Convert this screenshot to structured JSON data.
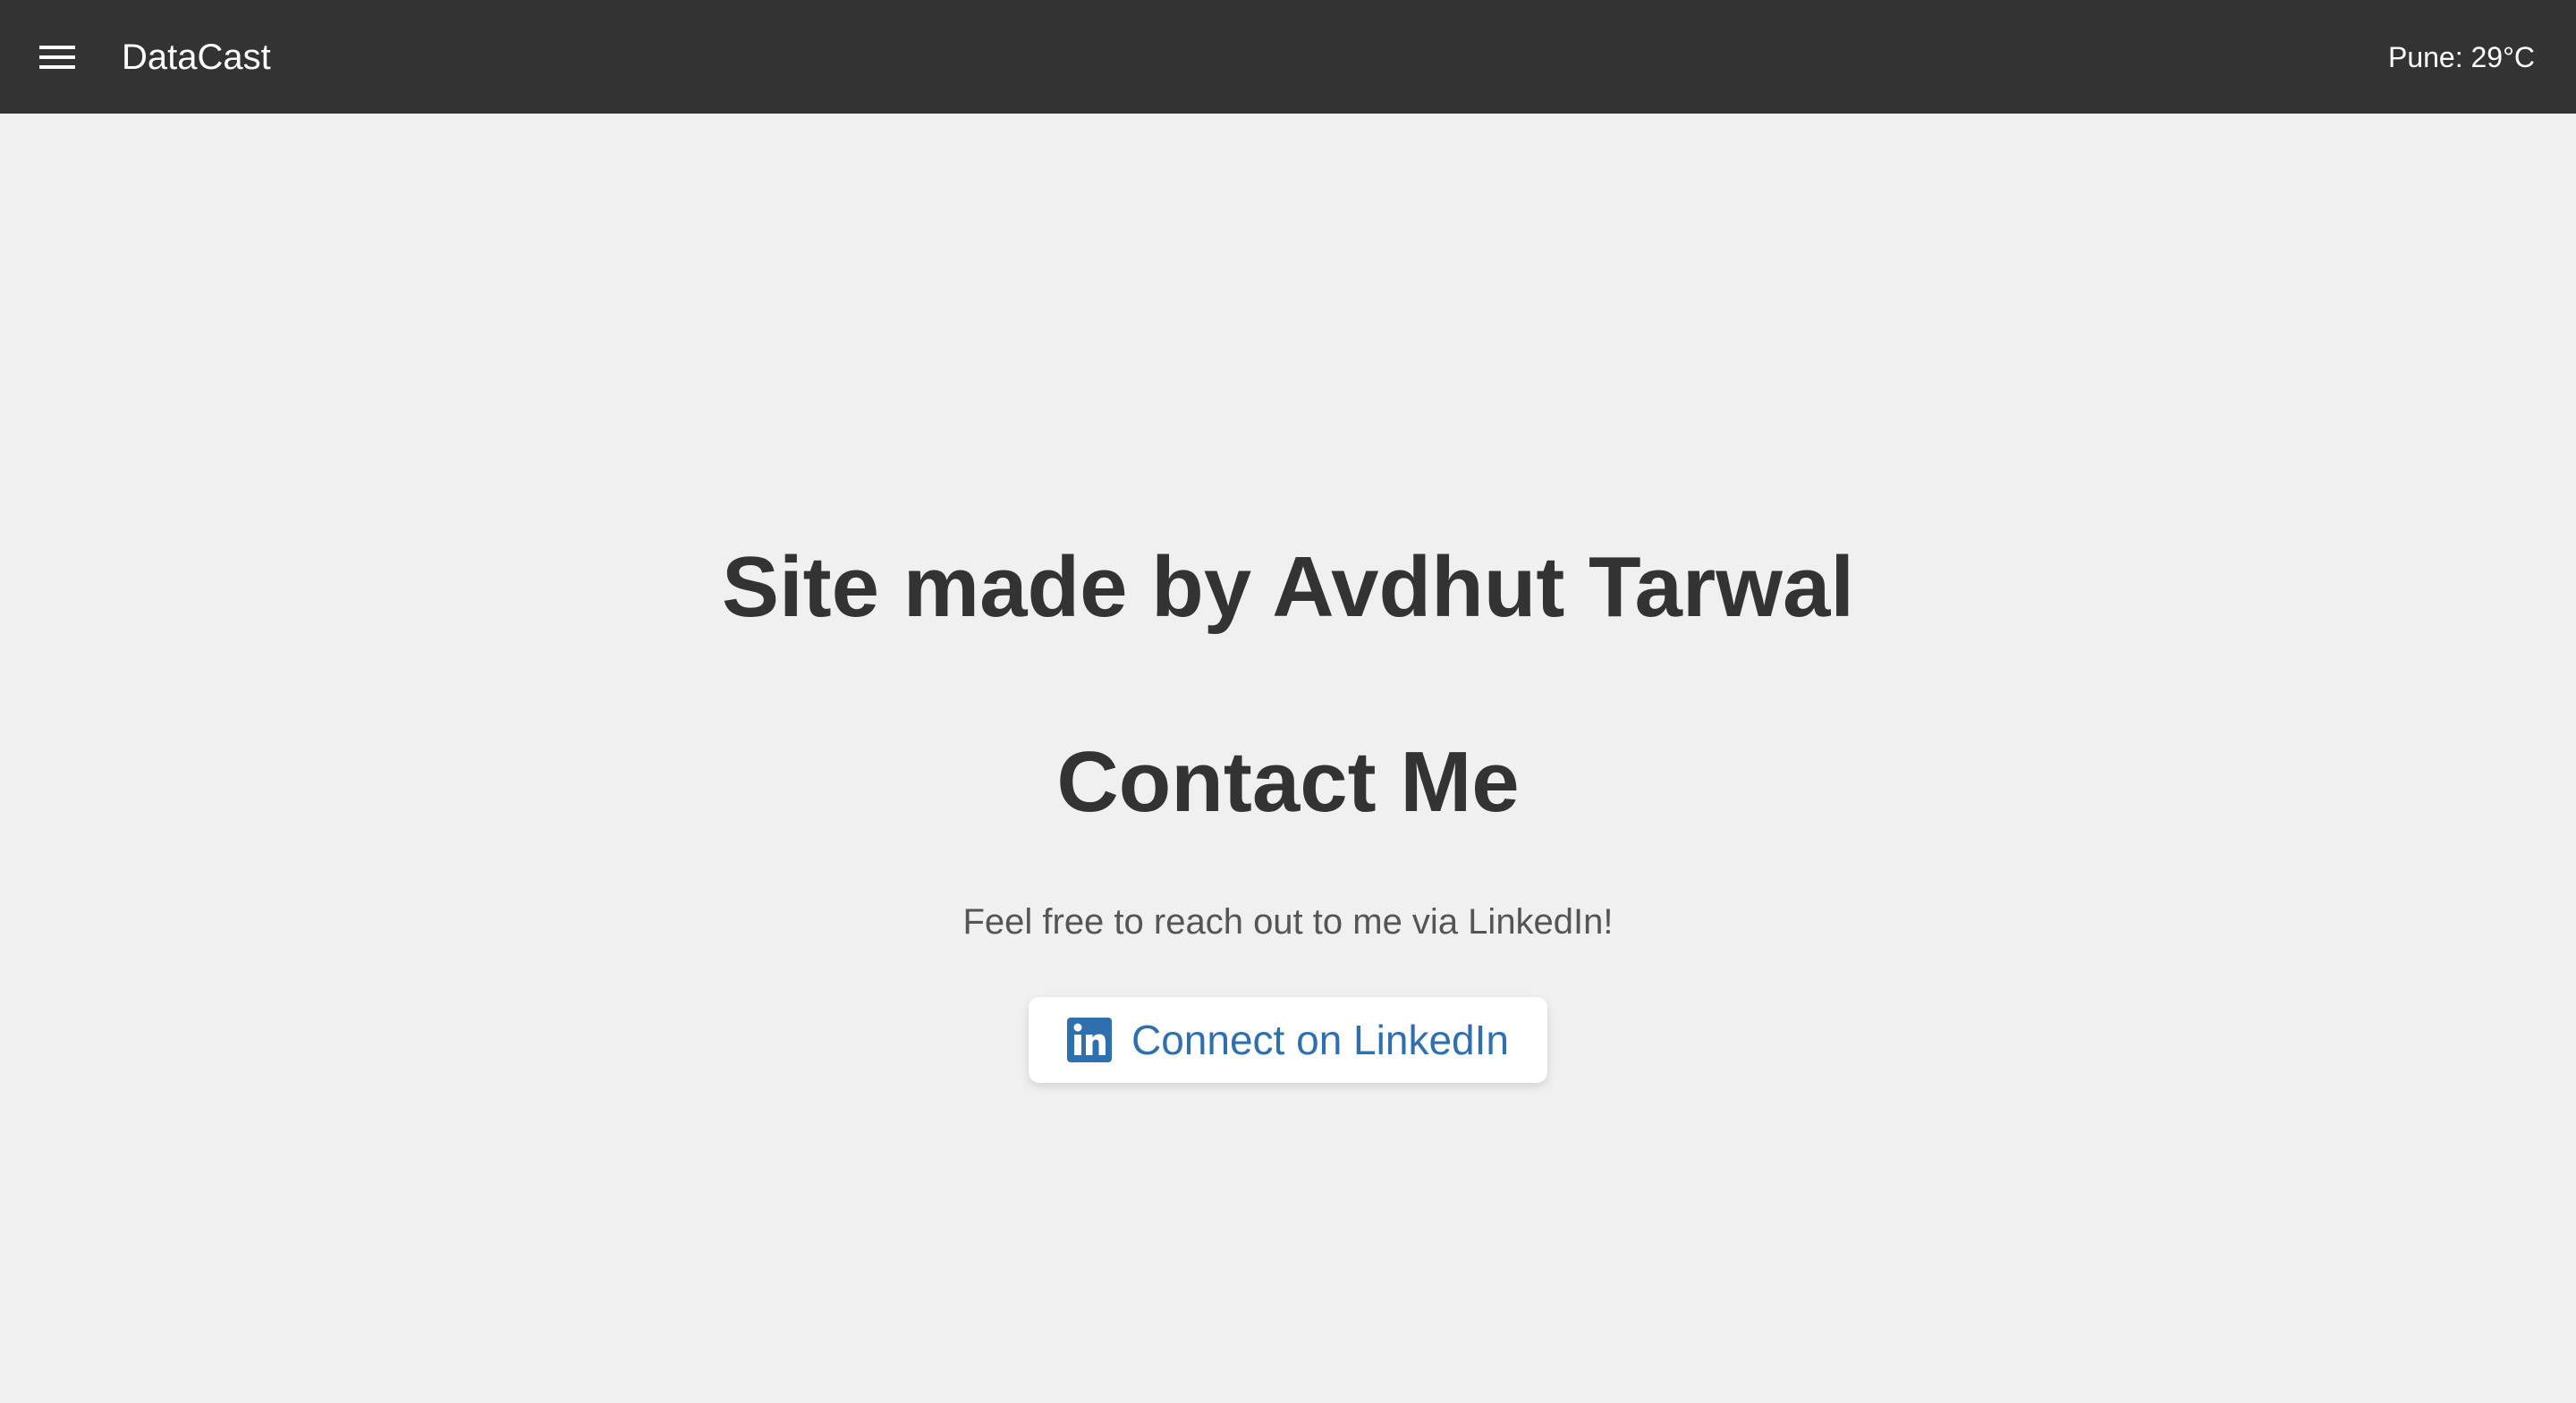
{
  "header": {
    "brand": "DataCast",
    "weather": "Pune: 29°C",
    "menu_icon": "hamburger-menu-icon"
  },
  "main": {
    "credit": "Site made by Avdhut Tarwal",
    "contact_title": "Contact Me",
    "contact_text": "Feel free to reach out to me via LinkedIn!",
    "linkedin_button": {
      "label": "Connect on LinkedIn",
      "icon": "linkedin-icon"
    }
  },
  "colors": {
    "topbar": "#333333",
    "background": "#f0f0f0",
    "heading": "#333333",
    "body_text": "#555555",
    "linkedin_blue": "#2e6fb0"
  }
}
